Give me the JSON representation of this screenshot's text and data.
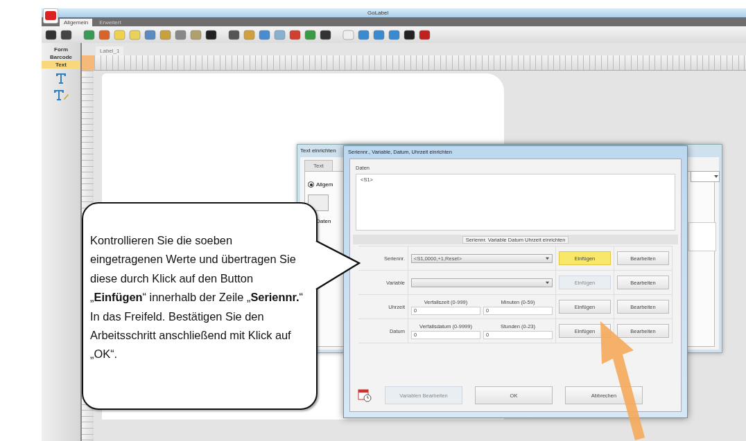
{
  "app": {
    "title": "GoLabel",
    "ribbon_tabs": [
      {
        "label": "Allgemein",
        "selected": true
      },
      {
        "label": "Erweitert",
        "selected": false
      }
    ],
    "palette": [
      {
        "label": "Form",
        "selected": false
      },
      {
        "label": "Barcode",
        "selected": false
      },
      {
        "label": "Text",
        "selected": true
      }
    ],
    "document_tab": "Label_1"
  },
  "text_dialog": {
    "title": "Text einrichten",
    "tab": "Text",
    "options": [
      {
        "label": "Allgem",
        "selected": true
      },
      {
        "label": "Daten"
      }
    ]
  },
  "serial_dialog": {
    "title": "Seriennr., Variable, Datum, Uhrzeit einrichten",
    "data_label": "Daten",
    "data_value": "<S1>",
    "group_title": "Seriennr. Variable Datum Uhrzeit einrichten",
    "rows": [
      {
        "kind": "select",
        "label": "Seriennr.",
        "value": "<S1,0000,+1,Reset>",
        "insert": "Einfügen",
        "insert_highlighted": true,
        "insert_disabled": false,
        "edit": "Bearbeiten"
      },
      {
        "kind": "select",
        "label": "Variable",
        "insert": "Einfügen",
        "insert_highlighted": false,
        "insert_disabled": true,
        "edit": "Bearbeiten"
      },
      {
        "kind": "offset",
        "label": "Uhrzeit",
        "caption1": "Verfallszeit (0-999)",
        "value1": "0",
        "caption2": "Minuten (0-59)",
        "value2": "0",
        "insert": "Einfügen",
        "insert_highlighted": false,
        "insert_disabled": false,
        "edit": "Bearbeiten"
      },
      {
        "kind": "offset",
        "label": "Datum",
        "caption1": "Verfallsdatum (0-9999)",
        "value1": "0",
        "caption2": "Stunden (0-23)",
        "value2": "0",
        "insert": "Einfügen",
        "insert_highlighted": false,
        "insert_disabled": false,
        "edit": "Bearbeiten"
      }
    ],
    "buttons": [
      {
        "label": "Variablen Bearbeiten",
        "disabled": true
      },
      {
        "label": "OK",
        "disabled": false
      },
      {
        "label": "Abbrechen",
        "disabled": false
      }
    ]
  },
  "callout": {
    "text": "Kontrollieren Sie die soeben eingetragenen Werte und übertragen Sie diese durch Klick auf den Button „**Einfügen**“ innerhalb der Zeile „**Seriennr.**“ In das Freifeld. Bestätigen Sie den Arbeitsschritt anschließend mit Klick auf „OK“."
  }
}
